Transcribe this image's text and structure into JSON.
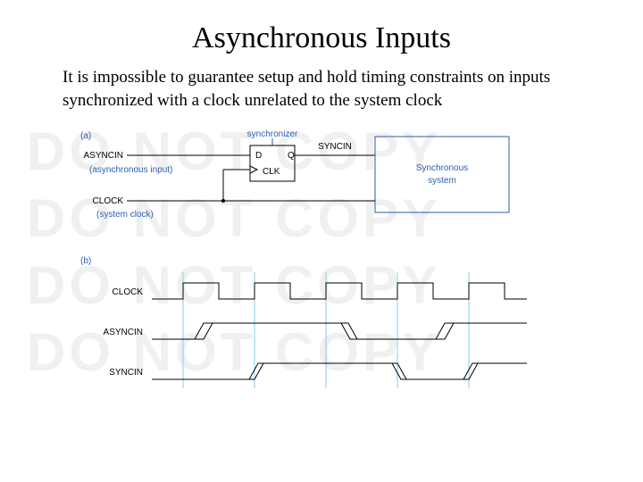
{
  "title": "Asynchronous Inputs",
  "body": "It is impossible to guarantee setup and hold timing constraints on inputs synchronized with a clock unrelated to the system clock",
  "watermark": "DO NOT COPY",
  "fig": {
    "part_a": "(a)",
    "part_b": "(b)",
    "synchronizer": "synchronizer",
    "asyncin": "ASYNCIN",
    "asyncin_note": "(asynchronous input)",
    "clock": "CLOCK",
    "clock_note": "(system clock)",
    "syncin": "SYNCIN",
    "sync_system": "Synchronous system",
    "d": "D",
    "q": "Q",
    "clk": "CLK",
    "wave_clock": "CLOCK",
    "wave_asyncin": "ASYNCIN",
    "wave_syncin": "SYNCIN"
  }
}
